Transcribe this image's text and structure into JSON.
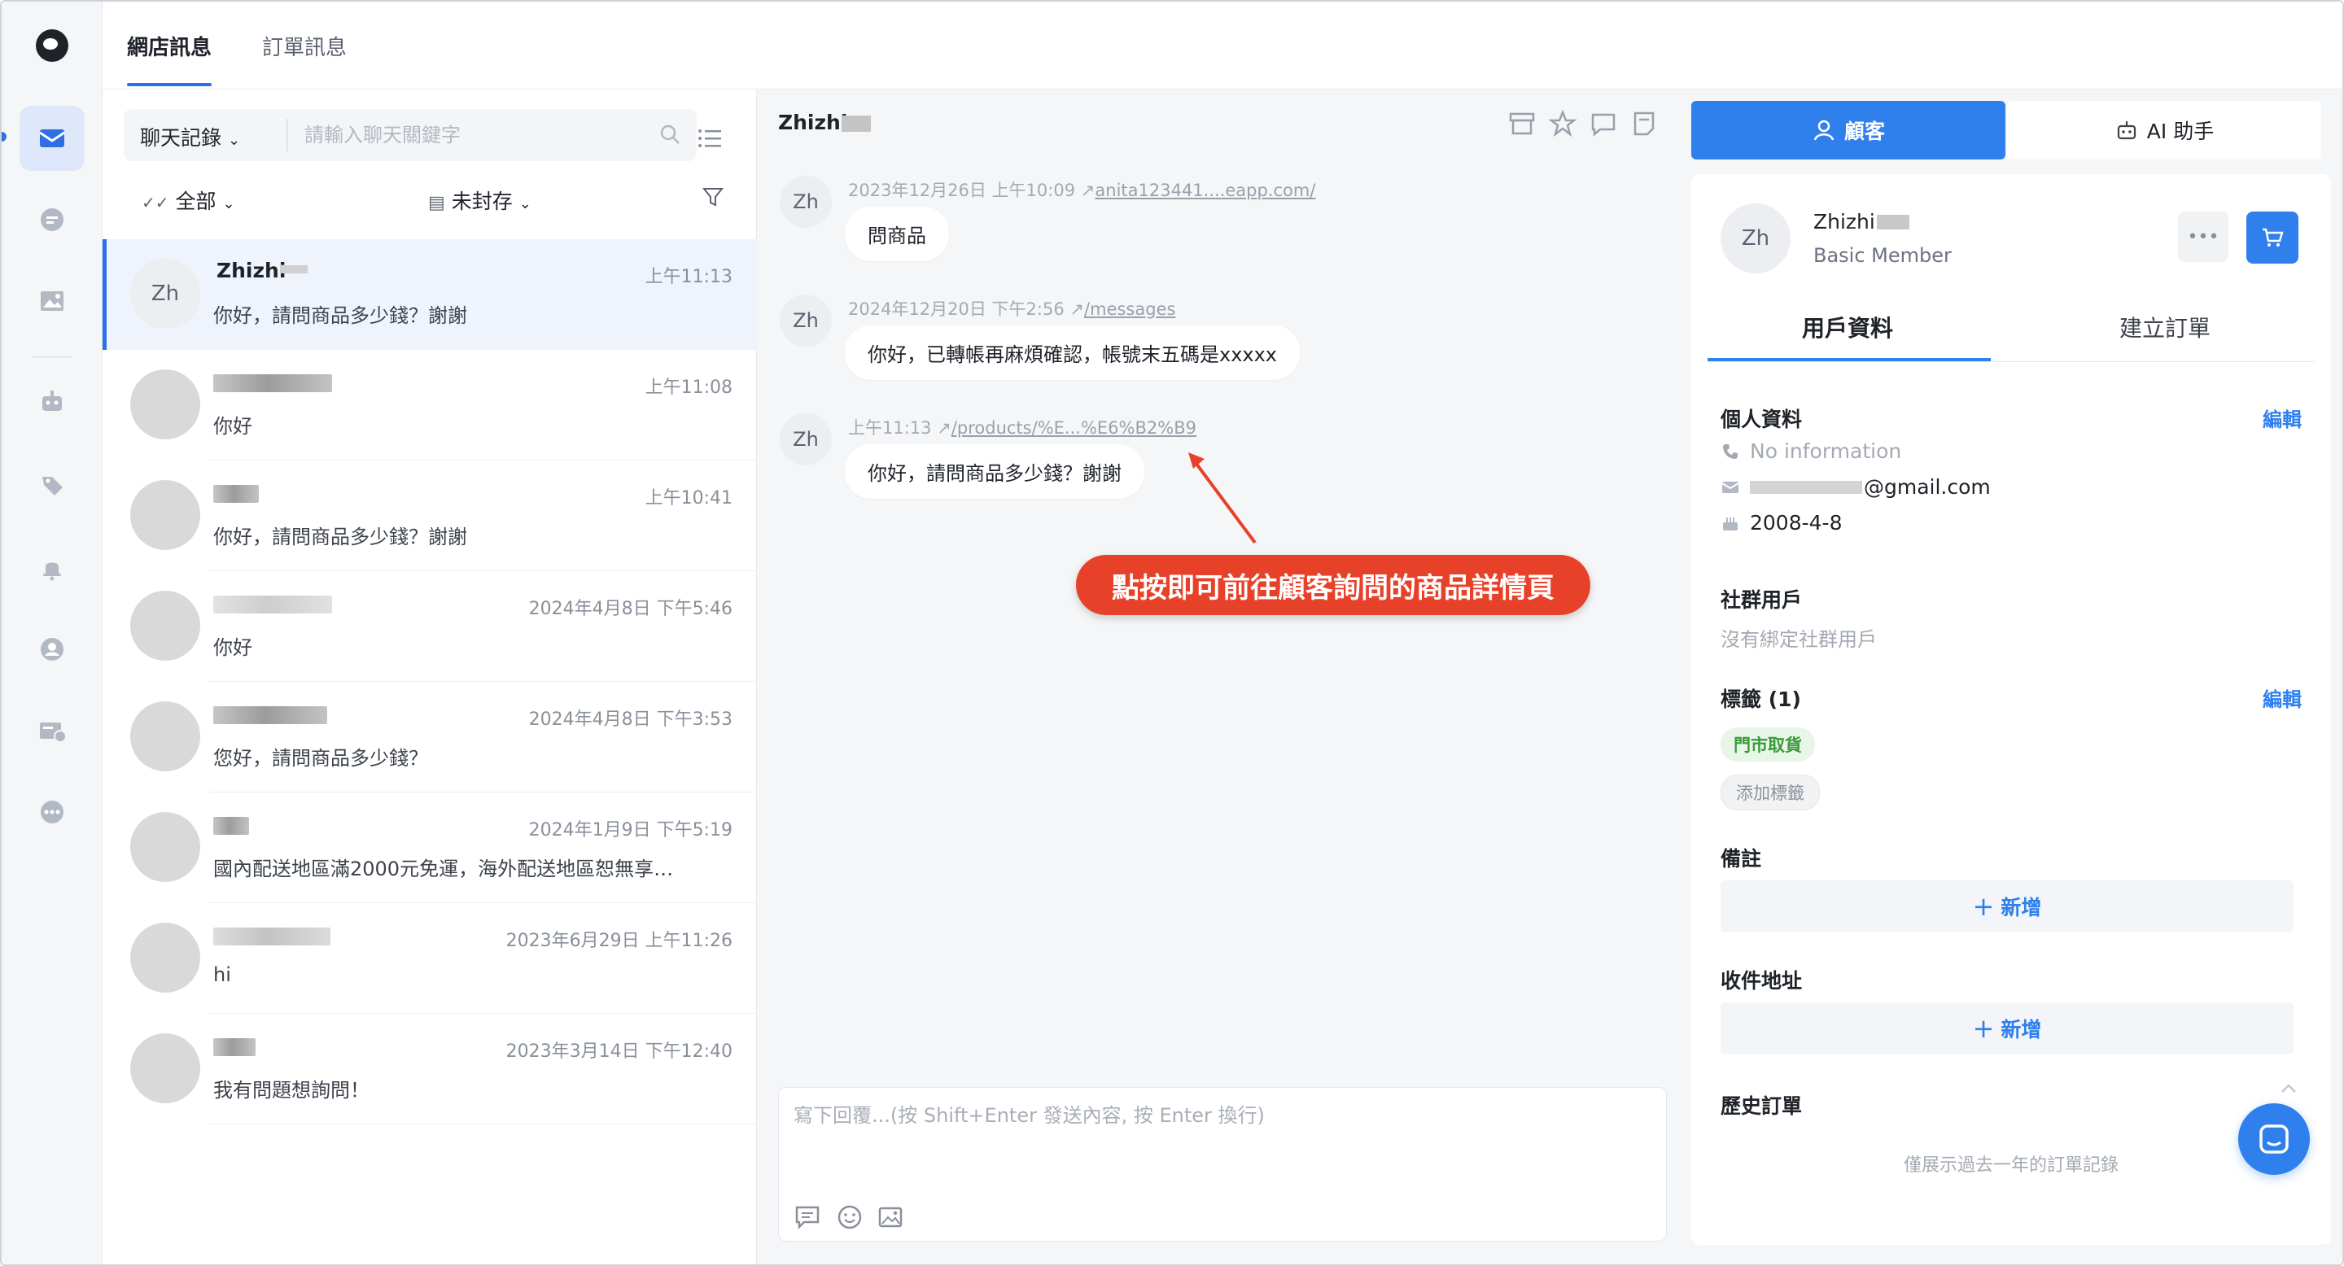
{
  "top_tabs": [
    {
      "label": "網店訊息",
      "active": true
    },
    {
      "label": "訂單訊息",
      "active": false
    }
  ],
  "rail_icons": [
    "app-logo",
    "inbox-icon",
    "chat-bubble-icon",
    "image-icon",
    "robot-icon",
    "tag-icon",
    "bell-icon",
    "support-agent-icon",
    "ticket-icon",
    "more-dots-icon"
  ],
  "list": {
    "search_select": "聊天記錄",
    "search_placeholder": "請輸入聊天關鍵字",
    "filter_all": "全部",
    "filter_archive": "未封存",
    "conversations": [
      {
        "name": "Zhizhi",
        "avatar_text": "Zh",
        "time": "上午11:13",
        "preview": "你好，請問商品多少錢？謝謝",
        "active": true
      },
      {
        "name": "",
        "time": "上午11:08",
        "preview": "你好"
      },
      {
        "name": "",
        "time": "上午10:41",
        "preview": "你好，請問商品多少錢？謝謝"
      },
      {
        "name": "",
        "time": "2024年4月8日 下午5:46",
        "preview": "你好"
      },
      {
        "name": "",
        "time": "2024年4月8日 下午3:53",
        "preview": "您好，請問商品多少錢？"
      },
      {
        "name": "",
        "time": "2024年1月9日 下午5:19",
        "preview": "國內配送地區滿2000元免運，海外配送地區恕無享…"
      },
      {
        "name": "",
        "time": "2023年6月29日 上午11:26",
        "preview": "hi"
      },
      {
        "name": "",
        "time": "2023年3月14日 下午12:40",
        "preview": "我有問題想詢問！"
      }
    ]
  },
  "chat": {
    "title": "Zhizhi",
    "messages": [
      {
        "avatar_text": "Zh",
        "time": "2023年12月26日 上午10:09",
        "link": "anita123441....eapp.com/",
        "text": "問商品"
      },
      {
        "avatar_text": "Zh",
        "time": "2024年12月20日 下午2:56",
        "link": "/messages",
        "text": "你好，已轉帳再麻煩確認，帳號末五碼是xxxxx"
      },
      {
        "avatar_text": "Zh",
        "time": "上午11:13",
        "link": "/products/%E...%E6%B2%B9",
        "text": "你好，請問商品多少錢？謝謝"
      }
    ],
    "callout": "點按即可前往顧客詢問的商品詳情頁",
    "composer_placeholder": "寫下回覆...(按 Shift+Enter 發送內容, 按 Enter 換行)"
  },
  "right": {
    "tab_customer": "顧客",
    "tab_ai": "AI 助手",
    "profile": {
      "avatar_text": "Zh",
      "name": "Zhizhi",
      "level": "Basic Member"
    },
    "sub_tabs": [
      "用戶資料",
      "建立訂單"
    ],
    "personal": {
      "title": "個人資料",
      "edit": "編輯",
      "phone": "No information",
      "email_suffix": "@gmail.com",
      "birthday": "2008-4-8"
    },
    "social": {
      "title": "社群用戶",
      "empty": "沒有綁定社群用戶"
    },
    "tags": {
      "title": "標籤 (1)",
      "edit": "編輯",
      "items": [
        "門市取貨"
      ],
      "add_label": "添加標籤"
    },
    "notes": {
      "title": "備註",
      "add": "新增"
    },
    "address": {
      "title": "收件地址",
      "add": "新增"
    },
    "history": {
      "title": "歷史訂單",
      "footnote": "僅展示過去一年的訂單記錄"
    }
  },
  "colors": {
    "accent": "#2f80ed",
    "callout": "#e8412a",
    "tag_green": "#3a9a3a"
  }
}
